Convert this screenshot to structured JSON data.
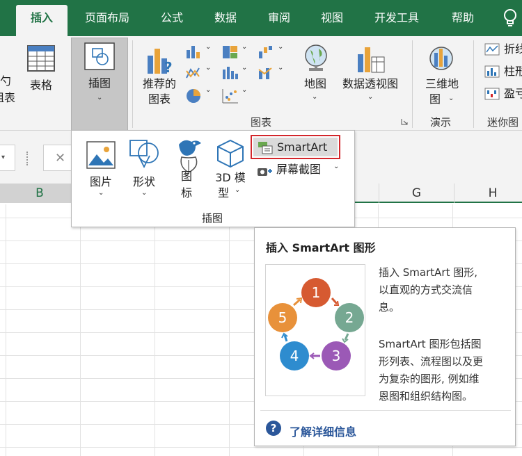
{
  "tabs": [
    {
      "label": "插入"
    },
    {
      "label": "页面布局"
    },
    {
      "label": "公式"
    },
    {
      "label": "数据"
    },
    {
      "label": "审阅"
    },
    {
      "label": "视图"
    },
    {
      "label": "开发工具"
    },
    {
      "label": "帮助"
    }
  ],
  "ribbon": {
    "partial_left_1": "勺",
    "partial_left_2": "阻表",
    "table": "表格",
    "illustrations": "插图",
    "recommended_charts_1": "推荐的",
    "recommended_charts_2": "图表",
    "map": "地图",
    "pivot_chart": "数据透视图",
    "charts_group": "图表",
    "map3d_1": "三维地",
    "map3d_2": "图",
    "tours_group": "演示",
    "line_sparkline": "折线",
    "column_sparkline": "柱形",
    "winloss_sparkline": "盈亏",
    "sparklines_group": "迷你图"
  },
  "formula_bar": {
    "cancel_glyph": "✕"
  },
  "columns": [
    "B",
    "G",
    "H"
  ],
  "dropdown": {
    "pictures": "图片",
    "shapes": "形状",
    "icons_1": "图",
    "icons_2": "标",
    "model3d_1": "3D 模",
    "model3d_2": "型",
    "smartart": "SmartArt",
    "screenshot": "屏幕截图",
    "group_label": "插图"
  },
  "tooltip": {
    "title": "插入 SmartArt 图形",
    "desc1_l1": "插入 SmartArt 图形,",
    "desc1_l2": "以直观的方式交流信",
    "desc1_l3": "息。",
    "desc2_l1": "SmartArt 图形包括图",
    "desc2_l2": "形列表、流程图以及更",
    "desc2_l3": "为复杂的图形, 例如维",
    "desc2_l4": "恩图和组织结构图。",
    "link": "了解详细信息",
    "help_glyph": "?",
    "cycle_numbers": [
      "1",
      "2",
      "3",
      "4",
      "5"
    ]
  },
  "colors": {
    "brand": "#217346",
    "highlight": "#d3262b",
    "link": "#2b579a"
  }
}
